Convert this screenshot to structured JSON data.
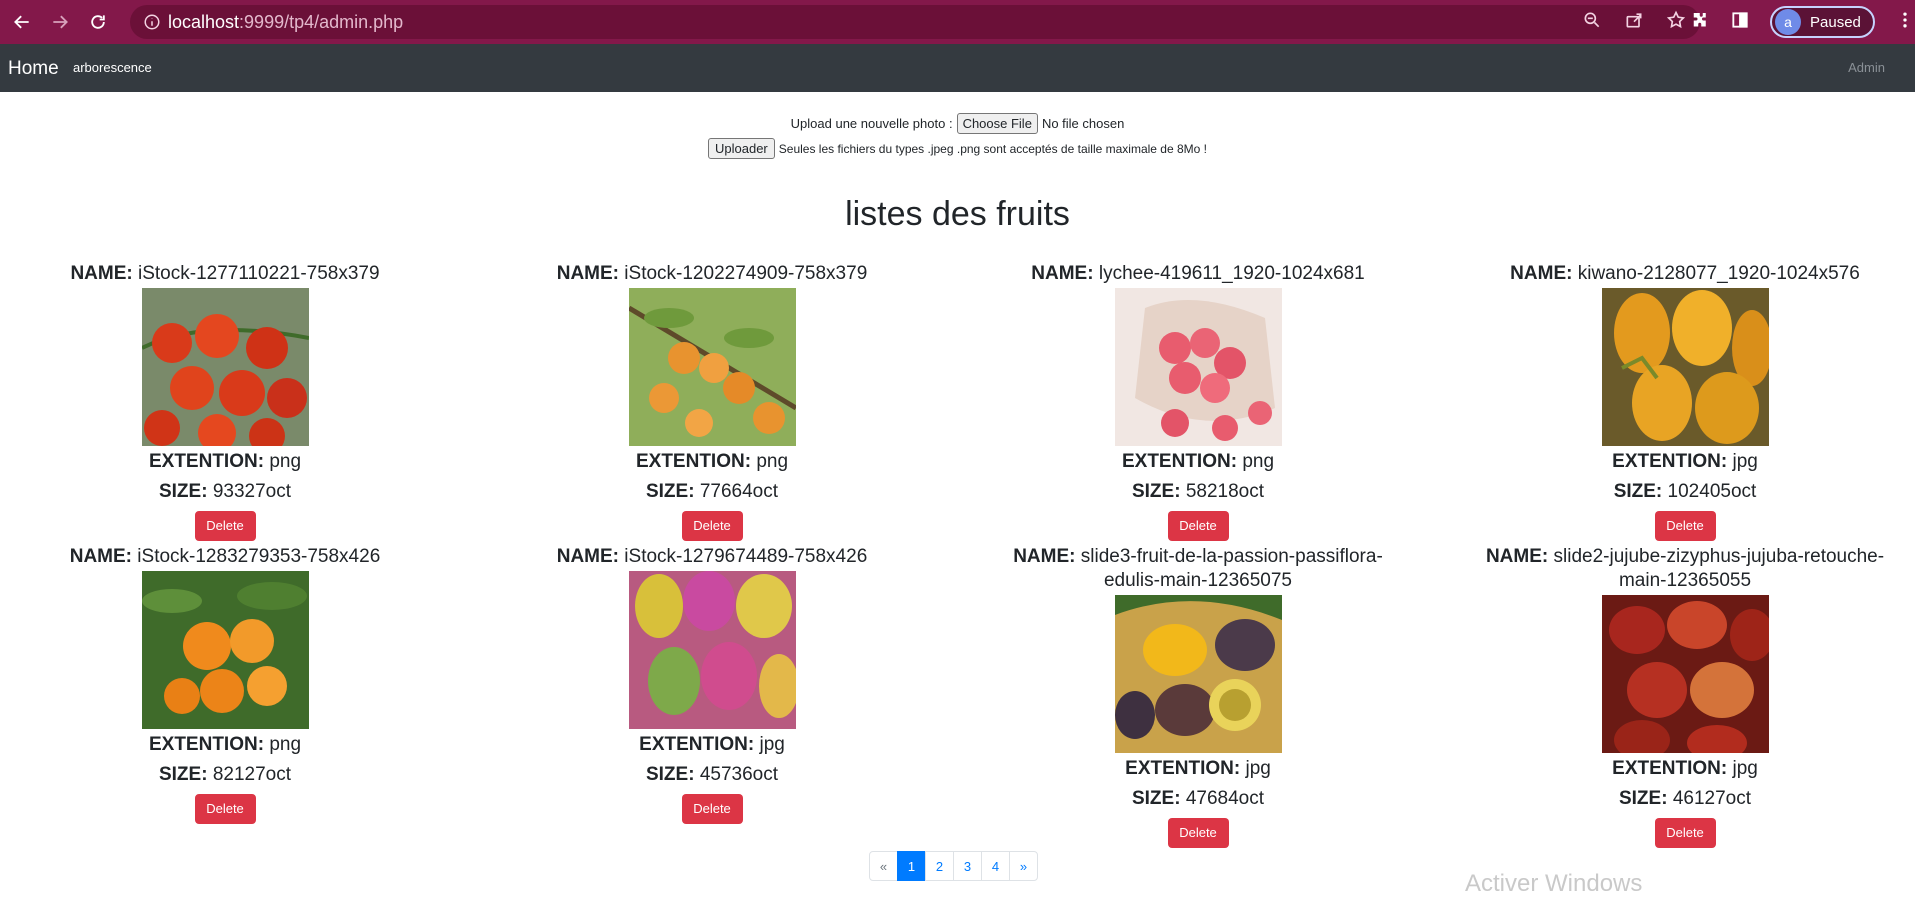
{
  "browser": {
    "url_host": "localhost",
    "url_rest": ":9999/tp4/admin.php",
    "profile_initial": "a",
    "profile_status": "Paused"
  },
  "navbar": {
    "brand": "Home",
    "link": "arborescence",
    "admin": "Admin"
  },
  "upload": {
    "label": "Upload une nouvelle photo :",
    "choose_file": "Choose File",
    "no_file": "No file chosen",
    "upload_button": "Uploader",
    "hint": "Seules les fichiers du types .jpeg .png sont acceptés de taille maximale de 8Mo !"
  },
  "title": "listes des fruits",
  "labels": {
    "name": "NAME:",
    "extension": "EXTENTION:",
    "size": "SIZE:",
    "delete": "Delete"
  },
  "fruits": [
    {
      "name": "iStock-1277110221-758x379",
      "ext": "png",
      "size": "93327oct",
      "image": "tomato-cherries",
      "colors": [
        "#d93a1a",
        "#5a8a3a"
      ]
    },
    {
      "name": "iStock-1202274909-758x379",
      "ext": "png",
      "size": "77664oct",
      "image": "apricots-on-branch",
      "colors": [
        "#e8932f",
        "#6f9a3c"
      ]
    },
    {
      "name": "lychee-419611_1920-1024x681",
      "ext": "png",
      "size": "58218oct",
      "image": "lychees-in-bowl",
      "colors": [
        "#e85c6e",
        "#f1e7e3"
      ]
    },
    {
      "name": "kiwano-2128077_1920-1024x576",
      "ext": "jpg",
      "size": "102405oct",
      "image": "kiwano-fruits",
      "colors": [
        "#e39a1e",
        "#7a8a2a"
      ]
    },
    {
      "name": "iStock-1283279353-758x426",
      "ext": "png",
      "size": "82127oct",
      "image": "kumquats-on-tree",
      "colors": [
        "#f08a1c",
        "#3f6b2a"
      ]
    },
    {
      "name": "iStock-1279674489-758x426",
      "ext": "jpg",
      "size": "45736oct",
      "image": "prickly-pears",
      "colors": [
        "#c94aa0",
        "#d8c03a"
      ]
    },
    {
      "name": "slide3-fruit-de-la-passion-passiflora-edulis-main-12365075",
      "ext": "jpg",
      "size": "47684oct",
      "image": "passion-fruits-basket",
      "colors": [
        "#f2b81a",
        "#4b3a4a"
      ]
    },
    {
      "name": "slide2-jujube-zizyphus-jujuba-retouche-main-12365055",
      "ext": "jpg",
      "size": "46127oct",
      "image": "jujubes",
      "colors": [
        "#a8261e",
        "#6b1a14"
      ]
    }
  ],
  "pagination": {
    "prev": "«",
    "pages": [
      "1",
      "2",
      "3",
      "4"
    ],
    "next": "»",
    "active": "1"
  },
  "watermark": "Activer Windows"
}
